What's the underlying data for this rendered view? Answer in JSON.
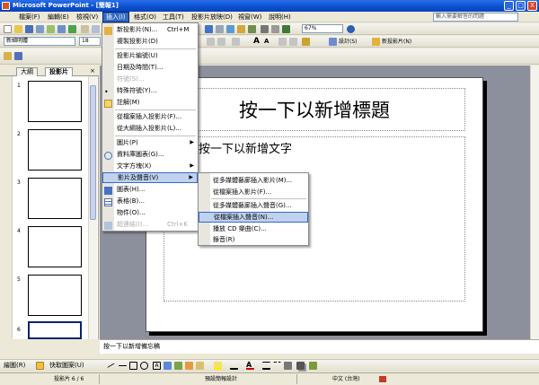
{
  "window": {
    "title": "Microsoft PowerPoint - [簡報1]",
    "min": "_",
    "max": "□",
    "close": "X"
  },
  "menubar": {
    "items": [
      "檔案(F)",
      "編輯(E)",
      "檢視(V)",
      "插入(I)",
      "格式(O)",
      "工具(T)",
      "投影片放映(D)",
      "視窗(W)",
      "說明(H)"
    ],
    "help_placeholder": "輸入需要解答的問題"
  },
  "toolbar": {
    "font_name": "新細明體",
    "font_size": "18",
    "zoom": "67%",
    "design_label": "設計(S)",
    "new_slide_label": "新投影片(N)"
  },
  "leftpane": {
    "tabs": [
      "大綱",
      "投影片"
    ],
    "slide_numbers": [
      "1",
      "2",
      "3",
      "4",
      "5",
      "6"
    ]
  },
  "slide": {
    "title_placeholder": "按一下以新增標題",
    "body_placeholder": "按一下以新增文字"
  },
  "notes_placeholder": "按一下以新增備忘稿",
  "insert_menu": {
    "items": [
      {
        "label": "新投影片(N)...",
        "shortcut": "Ctrl+M"
      },
      {
        "label": "複製投影片(D)"
      },
      {
        "label": "投影片編號(U)"
      },
      {
        "label": "日期及時間(T)..."
      },
      {
        "label": "符號(S)...",
        "disabled": true
      },
      {
        "label": "特殊符號(Y)..."
      },
      {
        "label": "註解(M)"
      },
      {
        "label": "從檔案插入投影片(F)..."
      },
      {
        "label": "從大綱插入投影片(L)..."
      },
      {
        "label": "圖片(P)"
      },
      {
        "label": "資料庫圖表(G)..."
      },
      {
        "label": "文字方塊(X)"
      },
      {
        "label": "影片及聲音(V)"
      },
      {
        "label": "圖表(H)..."
      },
      {
        "label": "表格(B)..."
      },
      {
        "label": "物件(O)..."
      },
      {
        "label": "超連結(I)...",
        "shortcut": "Ctrl+K",
        "disabled": true
      }
    ]
  },
  "media_submenu": {
    "items": [
      "從多媒體藝廊插入影片(M)...",
      "從檔案插入影片(F)...",
      "從多媒體藝廊插入聲音(G)...",
      "從檔案插入聲音(N)...",
      "播放 CD 樂曲(C)...",
      "錄音(R)"
    ]
  },
  "drawing_toolbar": {
    "draw_label": "繪圖(R)",
    "autoshapes_label": "快取圖案(U)"
  },
  "statusbar": {
    "slide_info": "投影片 6 / 6",
    "design": "預設簡報設計",
    "language": "中文 (台灣)"
  },
  "colors": {
    "titlebar": "#0a4fd0",
    "menu_highlight": "#316ac5",
    "stage": "#8c8f9c"
  }
}
